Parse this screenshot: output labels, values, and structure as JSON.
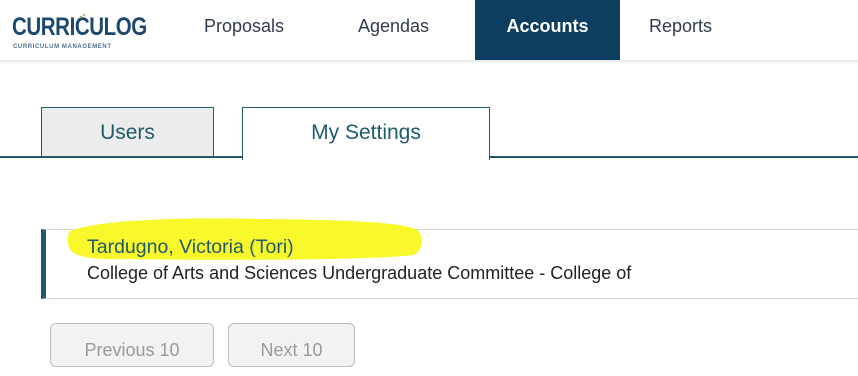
{
  "header": {
    "logo": {
      "main": "CURRICULOG",
      "sub": "CURRICULUM MANAGEMENT"
    },
    "nav": [
      {
        "label": "Proposals",
        "active": false
      },
      {
        "label": "Agendas",
        "active": false
      },
      {
        "label": "Accounts",
        "active": true
      },
      {
        "label": "Reports",
        "active": false
      }
    ]
  },
  "tabs": [
    {
      "label": "Users",
      "active": false
    },
    {
      "label": "My Settings",
      "active": true
    }
  ],
  "user_card": {
    "name": "Tardugno, Victoria (Tori)",
    "subtitle": "College of Arts and Sciences Undergraduate Committee - College of",
    "highlight_color": "#f8f82a"
  },
  "pager": {
    "previous_label": "Previous 10",
    "next_label": "Next 10"
  },
  "colors": {
    "brand_navy": "#0d3e60",
    "accent_teal": "#1f5a6d"
  }
}
